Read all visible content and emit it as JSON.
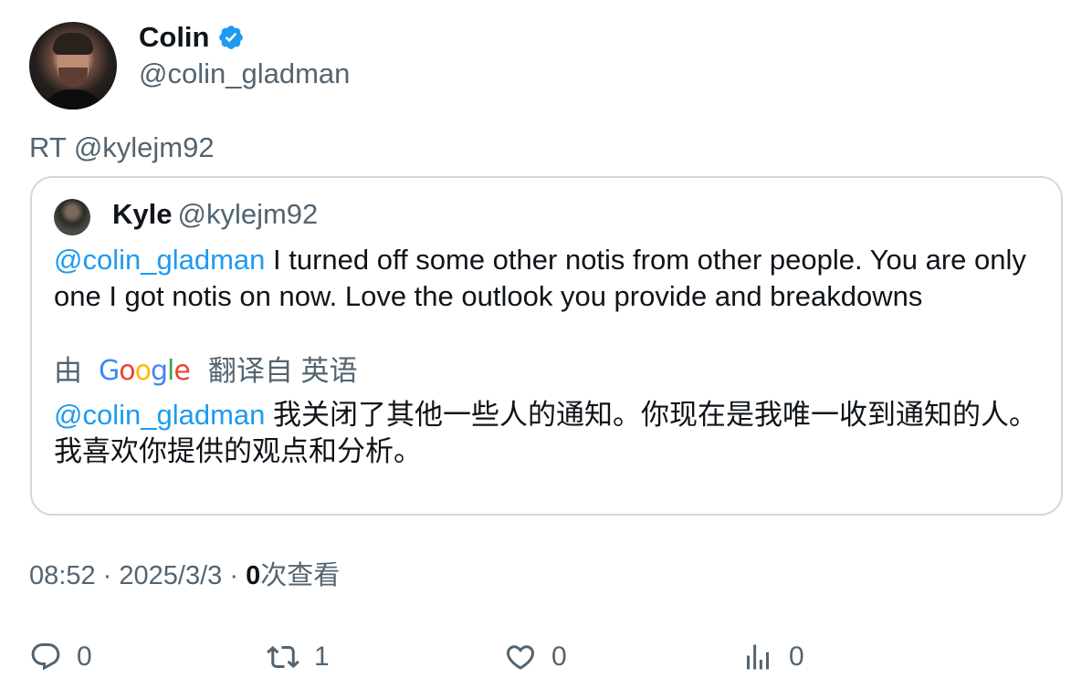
{
  "author": {
    "display_name": "Colin",
    "handle": "@colin_gladman",
    "verified_icon": "verified-badge-icon"
  },
  "retweet_line": "RT @kylejm92",
  "quoted_tweet": {
    "display_name": "Kyle",
    "handle": "@kylejm92",
    "mention": "@colin_gladman",
    "text": " I turned off some other notis from other people. You are only one I got notis on now. Love the outlook you provide and breakdowns",
    "translation_prefix": "由",
    "translation_logo": "Google",
    "translation_suffix": "翻译自 英语",
    "translated_mention": "@colin_gladman",
    "translated_text": " 我关闭了其他一些人的通知。你现在是我唯一收到通知的人。我喜欢你提供的观点和分析。"
  },
  "meta": {
    "time": "08:52",
    "separator": "·",
    "date": "2025/3/3",
    "views_count": "0",
    "views_label": "次查看"
  },
  "actions": {
    "replies": "0",
    "retweets": "1",
    "likes": "0",
    "views": "0"
  },
  "colors": {
    "accent": "#1d9bf0",
    "secondary_text": "#536471",
    "border": "#cfd9de"
  }
}
